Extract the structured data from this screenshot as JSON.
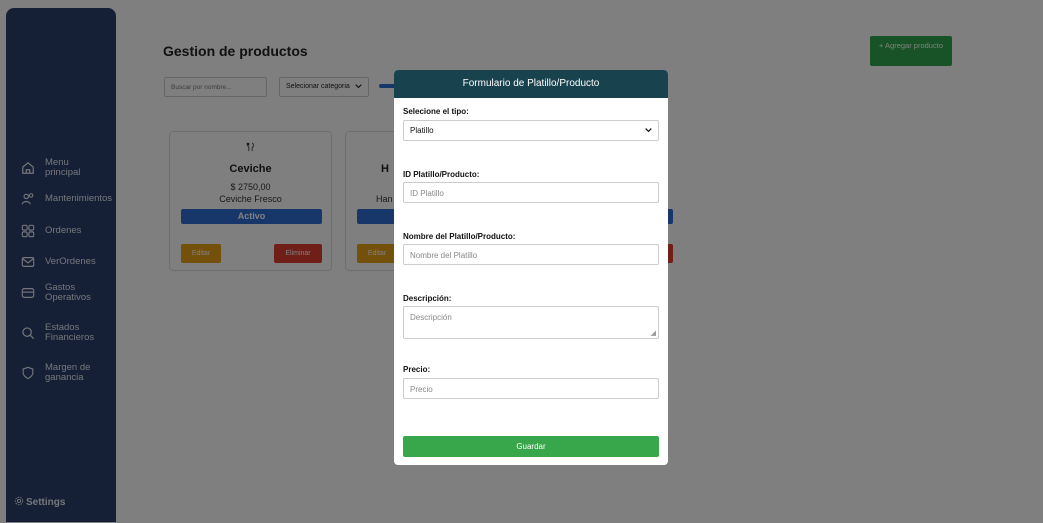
{
  "sidebar": {
    "items": [
      {
        "label": "Menu principal",
        "icon": "home-icon"
      },
      {
        "label": "Mantenimientos",
        "icon": "users-icon"
      },
      {
        "label": "Ordenes",
        "icon": "grid-icon"
      },
      {
        "label": "VerOrdenes",
        "icon": "mail-icon"
      },
      {
        "label": "Gastos Operativos",
        "icon": "card-icon"
      },
      {
        "label": "Estados Financieros",
        "icon": "search-icon"
      },
      {
        "label": "Margen de ganancia",
        "icon": "shield-icon"
      }
    ],
    "settings_label": "Settings"
  },
  "main": {
    "title": "Gestion de productos",
    "add_button": "+ Agregar producto",
    "search_placeholder": "Buscar por nombre...",
    "category_select": "Selecionar categoria",
    "cards": [
      {
        "name": "Ceviche",
        "price": "$ 2750,00",
        "description": "Ceviche Fresco",
        "status": "Activo",
        "edit": "Editar",
        "delete": "Eliminar"
      },
      {
        "name": "H",
        "price": "",
        "description": "Han",
        "status": "",
        "edit": "Editar",
        "delete": ""
      }
    ]
  },
  "modal": {
    "title": "Formulario de Platillo/Producto",
    "type_label": "Selecione el tipo:",
    "type_value": "Platillo",
    "id_label": "ID Platillo/Producto:",
    "id_placeholder": "ID Platillo",
    "name_label": "Nombre del Platillo/Producto:",
    "name_placeholder": "Nombre del Platillo",
    "desc_label": "Descripción:",
    "desc_placeholder": "Descripción",
    "price_label": "Precio:",
    "price_placeholder": "Precio",
    "save_button": "Guardar"
  },
  "colors": {
    "sidebar": "#2a3f6a",
    "modal_header": "#18424d",
    "save": "#38a64b",
    "active": "#2f6fd6",
    "edit": "#e8a317",
    "delete": "#e03c31"
  }
}
